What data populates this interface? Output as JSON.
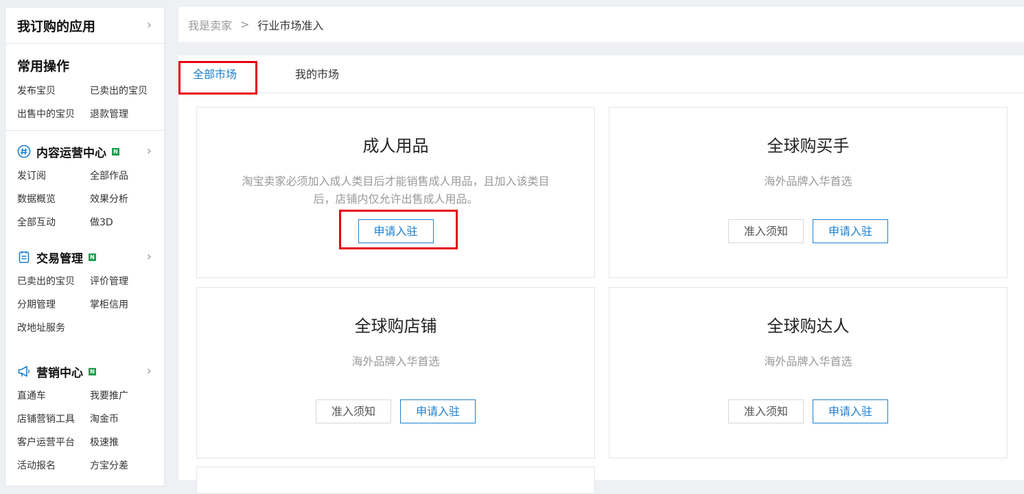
{
  "sidebar": {
    "apps_title": "我订购的应用",
    "common": {
      "title": "常用操作",
      "links": [
        "发布宝贝",
        "已卖出的宝贝",
        "出售中的宝贝",
        "退款管理"
      ]
    },
    "content": {
      "title": "内容运营中心",
      "badge": "N",
      "links": [
        "发订阅",
        "全部作品",
        "数据概览",
        "效果分析",
        "全部互动",
        "做3D"
      ]
    },
    "trade": {
      "title": "交易管理",
      "badge": "N",
      "links": [
        "已卖出的宝贝",
        "评价管理",
        "分期管理",
        "掌柜信用",
        "改地址服务"
      ]
    },
    "marketing": {
      "title": "营销中心",
      "badge": "N",
      "links": [
        "直通车",
        "我要推广",
        "店铺营销工具",
        "淘金币",
        "客户运营平台",
        "极速推",
        "活动报名",
        "方宝分差"
      ]
    }
  },
  "breadcrumb": {
    "root": "我是卖家",
    "separator": ">",
    "current": "行业市场准入"
  },
  "tabs": {
    "all": "全部市场",
    "mine": "我的市场"
  },
  "cards": [
    {
      "title": "成人用品",
      "desc": "淘宝卖家必须加入成人类目后才能销售成人用品，且加入该类目后，店铺内仅允许出售成人用品。",
      "apply_label": "申请入驻"
    },
    {
      "title": "全球购买手",
      "desc": "海外品牌入华首选",
      "notice_label": "准入须知",
      "apply_label": "申请入驻"
    },
    {
      "title": "全球购店铺",
      "desc": "海外品牌入华首选",
      "notice_label": "准入须知",
      "apply_label": "申请入驻"
    },
    {
      "title": "全球购达人",
      "desc": "海外品牌入华首选",
      "notice_label": "准入须知",
      "apply_label": "申请入驻"
    }
  ],
  "colors": {
    "accent": "#1a7fd1",
    "highlight": "#e60012",
    "badge": "#1f9e4f"
  }
}
